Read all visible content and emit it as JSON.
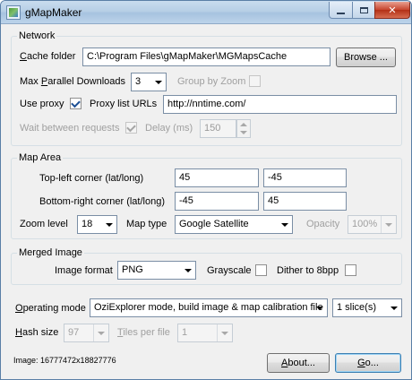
{
  "window": {
    "title": "gMapMaker"
  },
  "network": {
    "group_label": "Network",
    "cache_folder_label": "Cache folder",
    "cache_folder_value": "C:\\Program Files\\gMapMaker\\MGMapsCache",
    "browse_label": "Browse ...",
    "max_parallel_label": "Max Parallel Downloads",
    "max_parallel_value": "3",
    "group_by_zoom_label": "Group by Zoom",
    "use_proxy_label": "Use proxy",
    "use_proxy_checked": true,
    "proxy_list_label": "Proxy list URLs",
    "proxy_list_value": "http://nntime.com/",
    "wait_between_label": "Wait between requests",
    "delay_label": "Delay (ms)",
    "delay_value": "150"
  },
  "map_area": {
    "group_label": "Map Area",
    "top_left_label": "Top-left corner (lat/long)",
    "top_left_lat": "45",
    "top_left_long": "-45",
    "bottom_right_label": "Bottom-right corner (lat/long)",
    "bottom_right_lat": "-45",
    "bottom_right_long": "45",
    "zoom_label": "Zoom level",
    "zoom_value": "18",
    "map_type_label": "Map type",
    "map_type_value": "Google Satellite",
    "opacity_label": "Opacity",
    "opacity_value": "100%"
  },
  "merged_image": {
    "group_label": "Merged Image",
    "format_label": "Image format",
    "format_value": "PNG",
    "grayscale_label": "Grayscale",
    "dither_label": "Dither to 8bpp"
  },
  "bottom": {
    "operating_mode_label": "Operating mode",
    "operating_mode_value": "OziExplorer mode, build image & map calibration file",
    "slices_value": "1 slice(s)",
    "hash_size_label": "Hash size",
    "hash_size_value": "97",
    "tiles_per_file_label": "Tiles per file",
    "tiles_per_file_value": "1",
    "image_info": "Image: 16777472x18827776",
    "about_label": "About...",
    "go_label": "Go..."
  }
}
